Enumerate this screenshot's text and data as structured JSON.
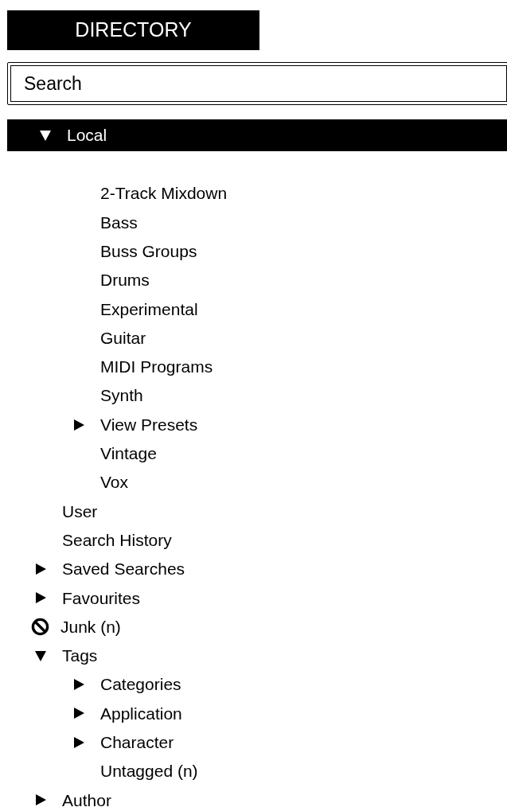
{
  "header": {
    "title": "DIRECTORY"
  },
  "search": {
    "placeholder": "Search"
  },
  "tree": [
    {
      "label": "Local",
      "kind": "folder",
      "expanded": true,
      "selected": true,
      "children": [
        {
          "label": "2-Track Mixdown",
          "kind": "leaf",
          "selected": false
        },
        {
          "label": "Bass",
          "kind": "leaf",
          "selected": false
        },
        {
          "label": "Buss Groups",
          "kind": "leaf",
          "selected": false
        },
        {
          "label": "Drums",
          "kind": "leaf",
          "selected": false
        },
        {
          "label": "Experimental",
          "kind": "leaf",
          "selected": false
        },
        {
          "label": "Guitar",
          "kind": "leaf",
          "selected": false
        },
        {
          "label": "MIDI Programs",
          "kind": "leaf",
          "selected": false
        },
        {
          "label": "Synth",
          "kind": "leaf",
          "selected": false
        },
        {
          "label": "View Presets",
          "kind": "folder",
          "expanded": false,
          "selected": false
        },
        {
          "label": "Vintage",
          "kind": "leaf",
          "selected": false
        },
        {
          "label": "Vox",
          "kind": "leaf",
          "selected": false
        }
      ]
    },
    {
      "label": "User",
      "kind": "leaf",
      "selected": false
    },
    {
      "label": "Search History",
      "kind": "leaf",
      "selected": false
    },
    {
      "label": "Saved Searches",
      "kind": "folder",
      "expanded": false,
      "selected": false
    },
    {
      "label": "Favourites",
      "kind": "folder",
      "expanded": false,
      "selected": false
    },
    {
      "label": "Junk (n)",
      "kind": "blocked",
      "selected": false
    },
    {
      "label": "Tags",
      "kind": "folder",
      "expanded": true,
      "selected": false,
      "children": [
        {
          "label": "Categories",
          "kind": "folder",
          "expanded": false,
          "selected": false
        },
        {
          "label": "Application",
          "kind": "folder",
          "expanded": false,
          "selected": false
        },
        {
          "label": "Character",
          "kind": "folder",
          "expanded": false,
          "selected": false
        },
        {
          "label": "Untagged (n)",
          "kind": "leaf",
          "selected": false
        }
      ]
    },
    {
      "label": "Author",
      "kind": "folder",
      "expanded": false,
      "selected": false
    }
  ]
}
